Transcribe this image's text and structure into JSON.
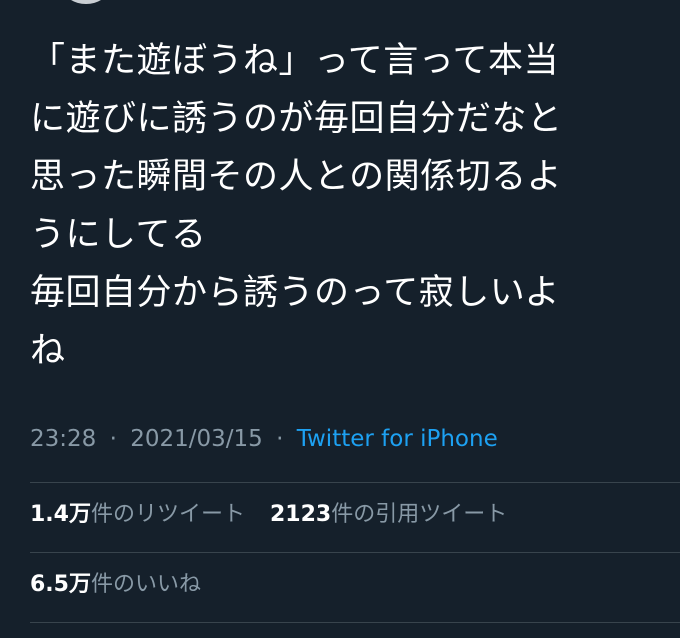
{
  "tweet": {
    "text_lines": [
      "「また遊ぼうね」って言って本当",
      "に遊びに誘うのが毎回自分だなと",
      "思った瞬間その人との関係切るよ",
      "うにしてる",
      "毎回自分から誘うのって寂しいよ",
      "ね"
    ],
    "time": "23:28",
    "date": "2021/03/15",
    "separator": "·",
    "source": "Twitter for iPhone"
  },
  "stats": {
    "retweets": {
      "value": "1.4万",
      "label": "件のリツイート"
    },
    "quotes": {
      "value": "2123",
      "label": "件の引用ツイート"
    },
    "likes": {
      "value": "6.5万",
      "label": "件のいいね"
    }
  },
  "colors": {
    "background": "#15202b",
    "text": "#ffffff",
    "muted": "#8899a6",
    "link": "#1da1f2",
    "divider": "#38444d"
  }
}
